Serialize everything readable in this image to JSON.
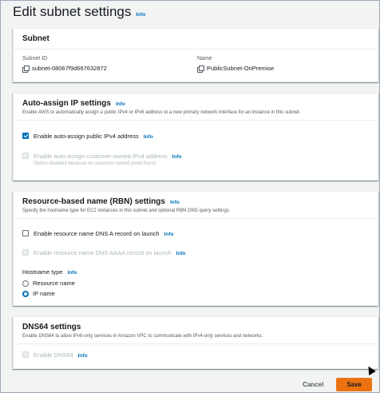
{
  "page": {
    "title": "Edit subnet settings",
    "info": "Info"
  },
  "subnet": {
    "title": "Subnet",
    "id_label": "Subnet ID",
    "id_value": "subnet-08067f9d667632872",
    "name_label": "Name",
    "name_value": "PublicSubnet-OnPremise"
  },
  "auto_ip": {
    "title": "Auto-assign IP settings",
    "info": "Info",
    "desc": "Enable AWS to automatically assign a public IPv4 or IPv6 address to a new primary network interface for an instance in this subnet.",
    "public_ipv4_label": "Enable auto-assign public IPv4 address",
    "public_ipv4_checked": true,
    "public_ipv4_info": "Info",
    "coip_label": "Enable auto-assign customer-owned IPv4 address",
    "coip_info": "Info",
    "coip_note": "Option disabled because no customer owned pools found."
  },
  "rbn": {
    "title": "Resource-based name (RBN) settings",
    "info": "Info",
    "desc": "Specify the hostname type for EC2 instances in this subnet and optional RBN DNS query settings.",
    "dns_a_label": "Enable resource name DNS A record on launch",
    "dns_a_info": "Info",
    "dns_aaaa_label": "Enable resource name DNS AAAA record on launch",
    "dns_aaaa_info": "Info",
    "hostname_label": "Hostname type",
    "hostname_info": "Info",
    "options": [
      "Resource name",
      "IP name"
    ],
    "selected": "IP name"
  },
  "dns64": {
    "title": "DNS64 settings",
    "desc": "Enable DNS64 to allow IPv6-only services in Amazon VPC to communicate with IPv4-only services and networks.",
    "enable_label": "Enable DNS64",
    "enable_info": "Info"
  },
  "footer": {
    "cancel": "Cancel",
    "save": "Save"
  },
  "colors": {
    "accent": "#0073bb",
    "primary_button": "#ec7211"
  }
}
